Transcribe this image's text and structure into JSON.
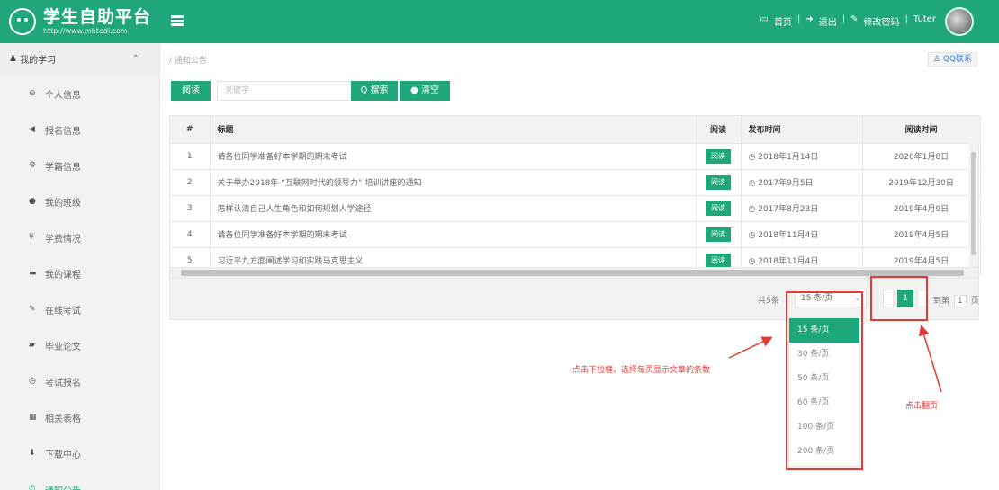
{
  "header": {
    "logo_title": "学生自助平台",
    "logo_url": "http://www.mhtedi.com",
    "links": [
      "首页",
      "退出",
      "修改密码"
    ],
    "username": "Tuter"
  },
  "sidebar": {
    "group_label": "我的学习",
    "items": [
      {
        "icon": "user-icon",
        "glyph": "⊖",
        "label": "个人信息"
      },
      {
        "icon": "volume-icon",
        "glyph": "◀",
        "label": "报名信息"
      },
      {
        "icon": "gear-icon",
        "glyph": "⚙",
        "label": "学籍信息"
      },
      {
        "icon": "dot-icon",
        "glyph": "●",
        "label": "我的班级"
      },
      {
        "icon": "yen-icon",
        "glyph": "¥",
        "label": "学费情况"
      },
      {
        "icon": "book-icon",
        "glyph": "▬",
        "label": "我的课程"
      },
      {
        "icon": "pencil-icon",
        "glyph": "✎",
        "label": "在线考试"
      },
      {
        "icon": "graduation-icon",
        "glyph": "▰",
        "label": "毕业论文"
      },
      {
        "icon": "clock-icon",
        "glyph": "◷",
        "label": "考试报名"
      },
      {
        "icon": "grid-icon",
        "glyph": "▦",
        "label": "相关表格"
      },
      {
        "icon": "download-icon",
        "glyph": "⬇",
        "label": "下载中心"
      },
      {
        "icon": "announce-icon",
        "glyph": "✆",
        "label": "通知公告"
      }
    ],
    "active_index": 11
  },
  "main": {
    "breadcrumb": "/ 通知公告",
    "qq_label": "QQ联系",
    "toolbar": {
      "read_label": "阅读",
      "search_placeholder": "关键字",
      "search_label": "Q 搜索",
      "clear_label": "● 清空"
    },
    "table": {
      "headers": [
        "#",
        "标题",
        "阅读",
        "发布时间",
        "阅读时间"
      ],
      "rows": [
        {
          "num": "1",
          "title": "请各位同学准备好本学期的期末考试",
          "read": "阅读",
          "publish": "◷ 2018年1月14日",
          "read_time": "2020年1月8日"
        },
        {
          "num": "2",
          "title": "关于举办2018年 “互联网时代的领导力” 培训讲座的通知",
          "read": "阅读",
          "publish": "◷ 2017年9月5日",
          "read_time": "2019年12月30日"
        },
        {
          "num": "3",
          "title": "怎样认清自己人生角色和如何规划人学途径",
          "read": "阅读",
          "publish": "◷ 2017年8月23日",
          "read_time": "2019年4月9日"
        },
        {
          "num": "4",
          "title": "请各位同学准备好本学期的期末考试",
          "read": "阅读",
          "publish": "◷ 2018年11月4日",
          "read_time": "2019年4月5日"
        },
        {
          "num": "5",
          "title": "习近平九方面阐述学习和实践马克思主义",
          "read": "阅读",
          "publish": "◷ 2018年11月4日",
          "read_time": "2019年4月5日"
        }
      ]
    },
    "pager": {
      "total": "共5条",
      "page_size": "15 条/页",
      "current_page": "1",
      "goto_prefix": "到第",
      "goto_value": "1",
      "goto_suffix": "页",
      "options": [
        "15 条/页",
        "30 条/页",
        "50 条/页",
        "60 条/页",
        "100 条/页",
        "200 条/页"
      ]
    },
    "annotations": {
      "dropdown_note": "点击下拉框，选择每页显示文章的条数",
      "page_note": "点击翻页"
    }
  },
  "colors": {
    "brand": "#1fa67a",
    "annotation": "#e53935"
  }
}
